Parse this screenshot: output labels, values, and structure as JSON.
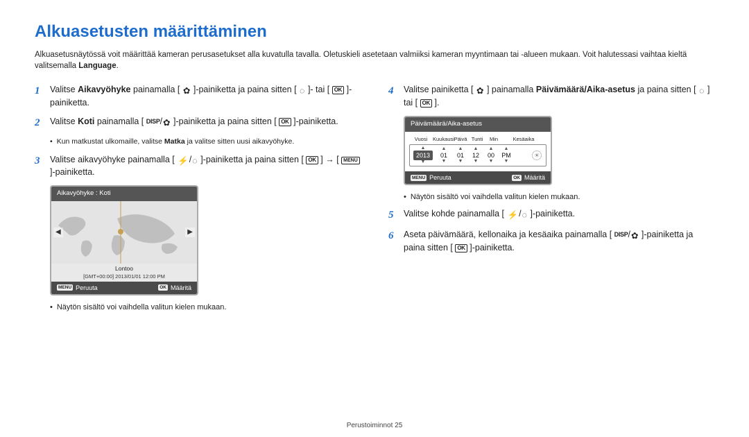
{
  "title": "Alkuasetusten määrittäminen",
  "intro_plain_1": "Alkuasetusnäytössä voit määrittää kameran perusasetukset alla kuvatulla tavalla. Oletuskieli asetetaan valmiiksi kameran myyntimaan tai -alueen mukaan. Voit halutessasi vaihtaa kieltä valitsemalla ",
  "intro_bold": "Language",
  "intro_plain_2": ".",
  "steps": {
    "s1": {
      "num": "1",
      "a": "Valitse ",
      "b1": "Aikavyöhyke",
      "c": " painamalla [",
      "d": "]-painiketta ja paina sitten [",
      "e": "]- tai [",
      "f": "]-painiketta."
    },
    "s2": {
      "num": "2",
      "a": "Valitse ",
      "b1": "Koti",
      "c": " painamalla [",
      "d": "]-painiketta ja paina sitten [",
      "e": "]-painiketta."
    },
    "s2_sub_a": "Kun matkustat ulkomaille, valitse ",
    "s2_sub_b": "Matka",
    "s2_sub_c": " ja valitse sitten uusi aikavyöhyke.",
    "s3": {
      "num": "3",
      "a": "Valitse aikavyöhyke painamalla [",
      "b": "]-painiketta ja paina sitten [",
      "c": "] → [",
      "d": "]-painiketta."
    },
    "s4": {
      "num": "4",
      "a": "Valitse painiketta [",
      "b": "] painamalla ",
      "bold": "Päivämäärä/Aika-asetus",
      "c": " ja paina sitten [",
      "d": "] tai [",
      "e": "]."
    },
    "s5": {
      "num": "5",
      "a": "Valitse kohde painamalla [",
      "b": "]-painiketta."
    },
    "s6": {
      "num": "6",
      "a": "Aseta päivämäärä, kellonaika ja kesäaika painamalla [",
      "b": "]-painiketta ja paina sitten [",
      "c": "]-painiketta."
    }
  },
  "map_panel": {
    "header": "Aikavyöhyke : Koti",
    "city": "Lontoo",
    "detail": "[GMT+00:00] 2013/01/01 12:00 PM",
    "cancel": "Peruuta",
    "confirm": "Määritä"
  },
  "dt_panel": {
    "header": "Päivämäärä/Aika-asetus",
    "labels": {
      "vuosi": "Vuosi",
      "kuukausi": "Kuukausi",
      "paiva": "Päivä",
      "tunti": "Tunti",
      "min": "Min",
      "kesa": "Kesäaika"
    },
    "values": {
      "year": "2013",
      "mon": "01",
      "day": "01",
      "hr": "12",
      "min": "00",
      "ampm": "PM"
    },
    "cancel": "Peruuta",
    "confirm": "Määritä"
  },
  "note_text": "Näytön sisältö voi vaihdella valitun kielen mukaan.",
  "footer": "Perustoiminnot  25",
  "icons": {
    "flower": "✿",
    "timer": "◌",
    "ok": "OK",
    "disp": "DISP",
    "menu": "MENU",
    "flash": "⚡"
  }
}
